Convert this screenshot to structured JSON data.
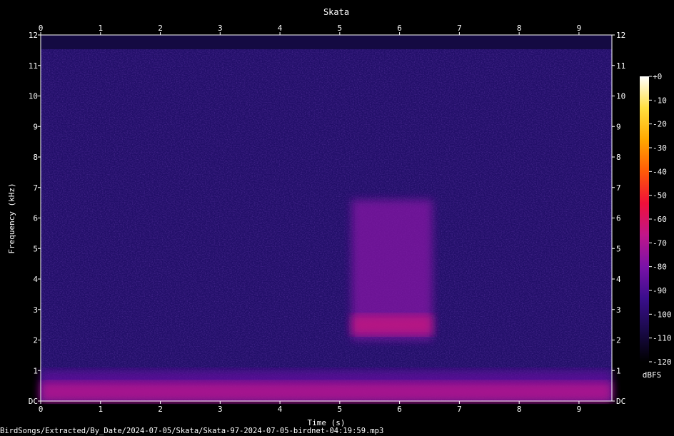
{
  "chart_data": {
    "type": "heatmap",
    "title": "Skata",
    "xlabel": "Time (s)",
    "ylabel": "Frequency (kHz)",
    "xlim": [
      0,
      9.55
    ],
    "ylim": [
      0,
      12
    ],
    "x_ticks": [
      "0",
      "1",
      "2",
      "3",
      "4",
      "5",
      "6",
      "7",
      "8",
      "9"
    ],
    "y_ticks": [
      "DC",
      "1",
      "2",
      "3",
      "4",
      "5",
      "6",
      "7",
      "8",
      "9",
      "10",
      "11",
      "12"
    ],
    "colorbar": {
      "label": "dBFS",
      "range": [
        -120,
        0
      ],
      "ticks": [
        "+0",
        "-10",
        "-20",
        "-30",
        "-40",
        "-50",
        "-60",
        "-70",
        "-80",
        "-90",
        "-100",
        "-110",
        "-120"
      ],
      "colors": [
        "#000000",
        "#1a0a4a",
        "#3a0e8c",
        "#7a12a8",
        "#c0168a",
        "#f0103a",
        "#ff5a08",
        "#ffa800",
        "#ffe040",
        "#ffffff"
      ]
    },
    "background_level_dbfs": -100,
    "noise_top_khz": 11.5,
    "events": [
      {
        "t_start": 5.2,
        "t_end": 6.55,
        "f_low": 2.0,
        "f_high": 6.6,
        "peak_khz": 2.5,
        "peak_dbfs": -65,
        "body_dbfs": -78
      },
      {
        "t_start": 0.0,
        "t_end": 9.55,
        "f_low": 0.0,
        "f_high": 1.0,
        "peak_khz": 0.3,
        "peak_dbfs": -68,
        "body_dbfs": -85
      }
    ],
    "filename": "BirdSongs/Extracted/By_Date/2024-07-05/Skata/Skata-97-2024-07-05-birdnet-04:19:59.mp3"
  }
}
